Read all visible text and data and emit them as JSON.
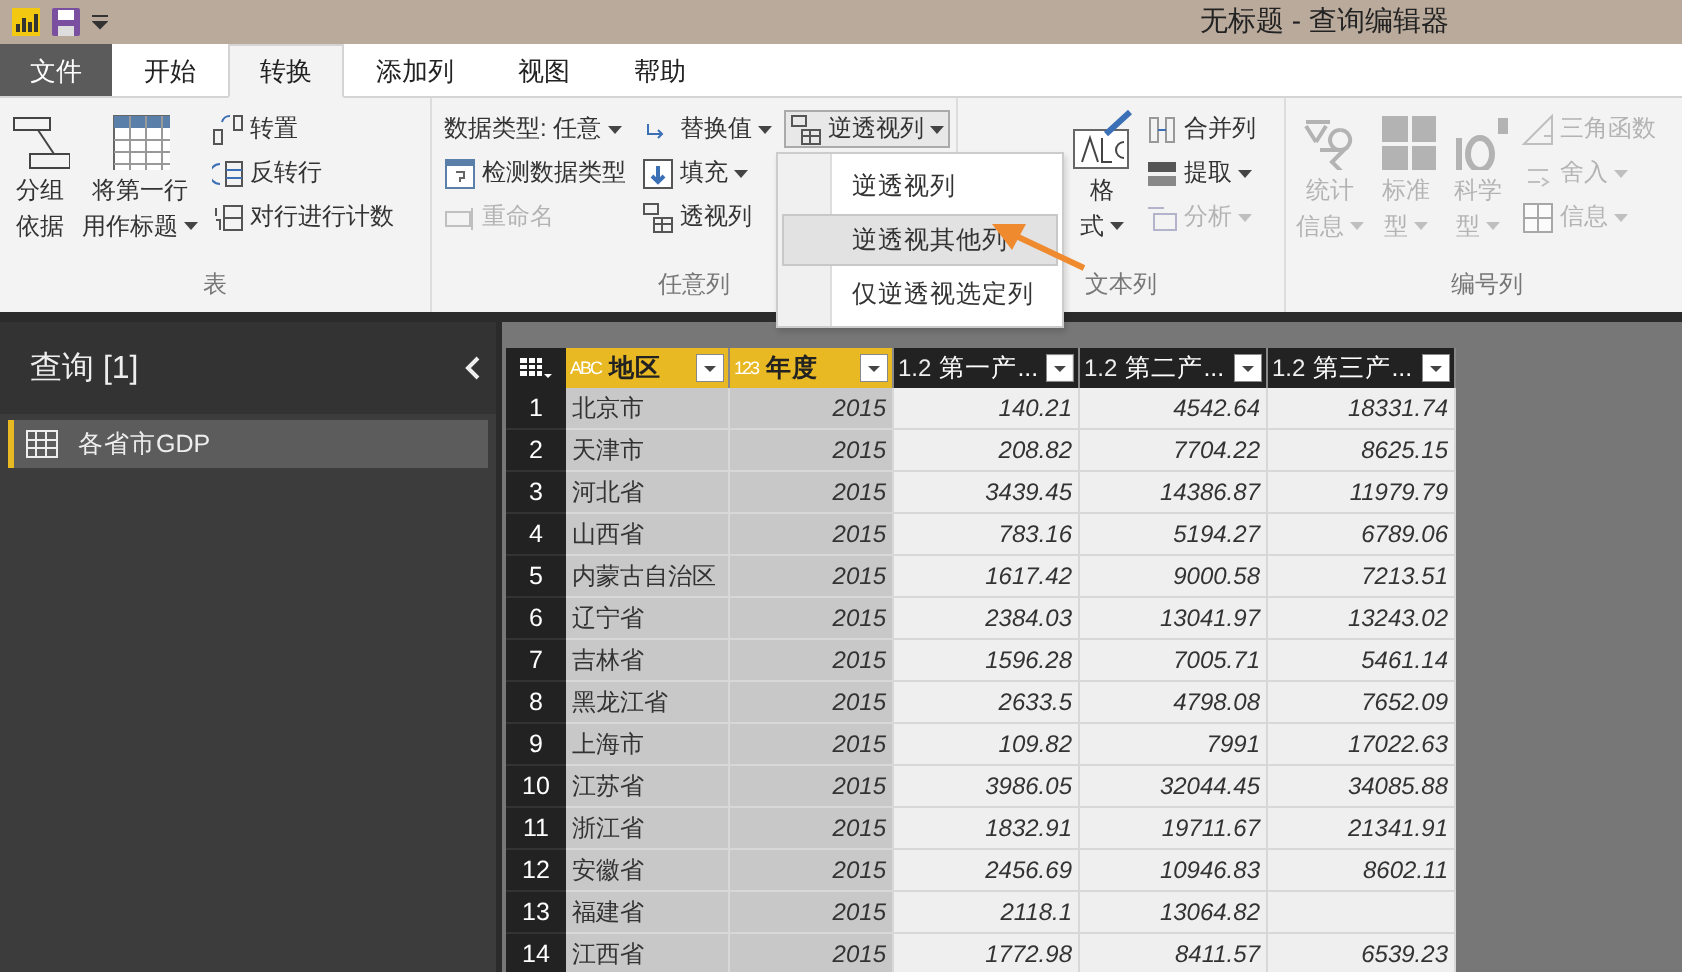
{
  "window": {
    "title": "无标题 - 查询编辑器"
  },
  "menu_tabs": [
    {
      "label": "文件",
      "kind": "file",
      "selected": false
    },
    {
      "label": "开始",
      "kind": "tab",
      "selected": false
    },
    {
      "label": "转换",
      "kind": "tab",
      "selected": true
    },
    {
      "label": "添加列",
      "kind": "tab",
      "selected": false
    },
    {
      "label": "视图",
      "kind": "tab",
      "selected": false
    },
    {
      "label": "帮助",
      "kind": "tab",
      "selected": false
    }
  ],
  "ribbon": {
    "groups": [
      {
        "label": "表",
        "columns": [
          [
            {
              "kind": "large",
              "lines": [
                "分组",
                "依据"
              ],
              "dropdown": false,
              "disabled": false
            }
          ],
          [
            {
              "kind": "large",
              "lines": [
                "将第一行",
                "用作标题"
              ],
              "dropdown": true,
              "disabled": false
            }
          ],
          [
            {
              "kind": "small",
              "lines": [
                "转置"
              ],
              "dropdown": false,
              "disabled": false
            },
            {
              "kind": "small",
              "lines": [
                "反转行"
              ],
              "dropdown": false,
              "disabled": false
            },
            {
              "kind": "small",
              "lines": [
                "对行进行计数"
              ],
              "dropdown": false,
              "disabled": false
            }
          ]
        ]
      },
      {
        "label": "任意列",
        "columns": [
          [
            {
              "kind": "small",
              "lines": [
                "数据类型: 任意"
              ],
              "dropdown": true,
              "disabled": false
            },
            {
              "kind": "small",
              "lines": [
                "检测数据类型"
              ],
              "dropdown": false,
              "disabled": false
            },
            {
              "kind": "small",
              "lines": [
                "重命名"
              ],
              "dropdown": false,
              "disabled": true
            }
          ],
          [
            {
              "kind": "small",
              "lines": [
                "替换值"
              ],
              "dropdown": true,
              "disabled": false
            },
            {
              "kind": "small",
              "lines": [
                "填充"
              ],
              "dropdown": true,
              "disabled": false
            },
            {
              "kind": "small",
              "lines": [
                "透视列"
              ],
              "dropdown": false,
              "disabled": false
            }
          ],
          [
            {
              "kind": "split",
              "lines": [
                "逆透视列"
              ],
              "dropdown": true,
              "disabled": false
            }
          ]
        ]
      },
      {
        "label": "文本列",
        "columns": [
          [
            {
              "kind": "large",
              "lines": [
                "格",
                "式"
              ],
              "dropdown": true,
              "disabled": false
            }
          ],
          [
            {
              "kind": "small",
              "lines": [
                "合并列"
              ],
              "dropdown": false,
              "disabled": false
            },
            {
              "kind": "small",
              "lines": [
                "提取"
              ],
              "dropdown": true,
              "disabled": false
            },
            {
              "kind": "small",
              "lines": [
                "分析"
              ],
              "dropdown": true,
              "disabled": true
            }
          ]
        ]
      },
      {
        "label": "编号列",
        "columns": [
          [
            {
              "kind": "large",
              "lines": [
                "统计",
                "信息"
              ],
              "dropdown": true,
              "disabled": true
            }
          ],
          [
            {
              "kind": "large",
              "lines": [
                "标准",
                "型"
              ],
              "dropdown": true,
              "disabled": true
            }
          ],
          [
            {
              "kind": "large",
              "lines": [
                "科学",
                "型"
              ],
              "dropdown": true,
              "disabled": true
            }
          ],
          [
            {
              "kind": "small",
              "lines": [
                "三角函数"
              ],
              "dropdown": false,
              "disabled": true
            },
            {
              "kind": "small",
              "lines": [
                "舍入"
              ],
              "dropdown": true,
              "disabled": true
            },
            {
              "kind": "small",
              "lines": [
                "信息"
              ],
              "dropdown": true,
              "disabled": true
            }
          ]
        ]
      }
    ]
  },
  "dropdown_menu": {
    "items": [
      {
        "label": "逆透视列",
        "selected": false
      },
      {
        "label": "逆透视其他列",
        "selected": true
      },
      {
        "label": "仅逆透视选定列",
        "selected": false
      }
    ]
  },
  "queries_panel": {
    "title": "查询 [1]",
    "items": [
      {
        "label": "各省市GDP",
        "selected": true
      }
    ]
  },
  "table": {
    "columns": [
      {
        "kind": "text",
        "type_mark": "ABC",
        "name": "地区",
        "selected": true
      },
      {
        "kind": "whole",
        "type_mark": "123",
        "name": "年度",
        "selected": true
      },
      {
        "kind": "decimal",
        "type_mark": "1.2",
        "name": "第一产...",
        "selected": false
      },
      {
        "kind": "decimal",
        "type_mark": "1.2",
        "name": "第二产...",
        "selected": false
      },
      {
        "kind": "decimal",
        "type_mark": "1.2",
        "name": "第三产...",
        "selected": false
      }
    ],
    "rows": [
      {
        "index": "1",
        "cells": [
          "北京市",
          "2015",
          "140.21",
          "4542.64",
          "18331.74"
        ]
      },
      {
        "index": "2",
        "cells": [
          "天津市",
          "2015",
          "208.82",
          "7704.22",
          "8625.15"
        ]
      },
      {
        "index": "3",
        "cells": [
          "河北省",
          "2015",
          "3439.45",
          "14386.87",
          "11979.79"
        ]
      },
      {
        "index": "4",
        "cells": [
          "山西省",
          "2015",
          "783.16",
          "5194.27",
          "6789.06"
        ]
      },
      {
        "index": "5",
        "cells": [
          "内蒙古自治区",
          "2015",
          "1617.42",
          "9000.58",
          "7213.51"
        ]
      },
      {
        "index": "6",
        "cells": [
          "辽宁省",
          "2015",
          "2384.03",
          "13041.97",
          "13243.02"
        ]
      },
      {
        "index": "7",
        "cells": [
          "吉林省",
          "2015",
          "1596.28",
          "7005.71",
          "5461.14"
        ]
      },
      {
        "index": "8",
        "cells": [
          "黑龙江省",
          "2015",
          "2633.5",
          "4798.08",
          "7652.09"
        ]
      },
      {
        "index": "9",
        "cells": [
          "上海市",
          "2015",
          "109.82",
          "7991",
          "17022.63"
        ]
      },
      {
        "index": "10",
        "cells": [
          "江苏省",
          "2015",
          "3986.05",
          "32044.45",
          "34085.88"
        ]
      },
      {
        "index": "11",
        "cells": [
          "浙江省",
          "2015",
          "1832.91",
          "19711.67",
          "21341.91"
        ]
      },
      {
        "index": "12",
        "cells": [
          "安徽省",
          "2015",
          "2456.69",
          "10946.83",
          "8602.11"
        ]
      },
      {
        "index": "13",
        "cells": [
          "福建省",
          "2015",
          "2118.1",
          "13064.82"
        ]
      },
      {
        "index": "14",
        "cells": [
          "江西省",
          "2015",
          "1772.98",
          "8411.57",
          "6539.23"
        ]
      }
    ]
  }
}
